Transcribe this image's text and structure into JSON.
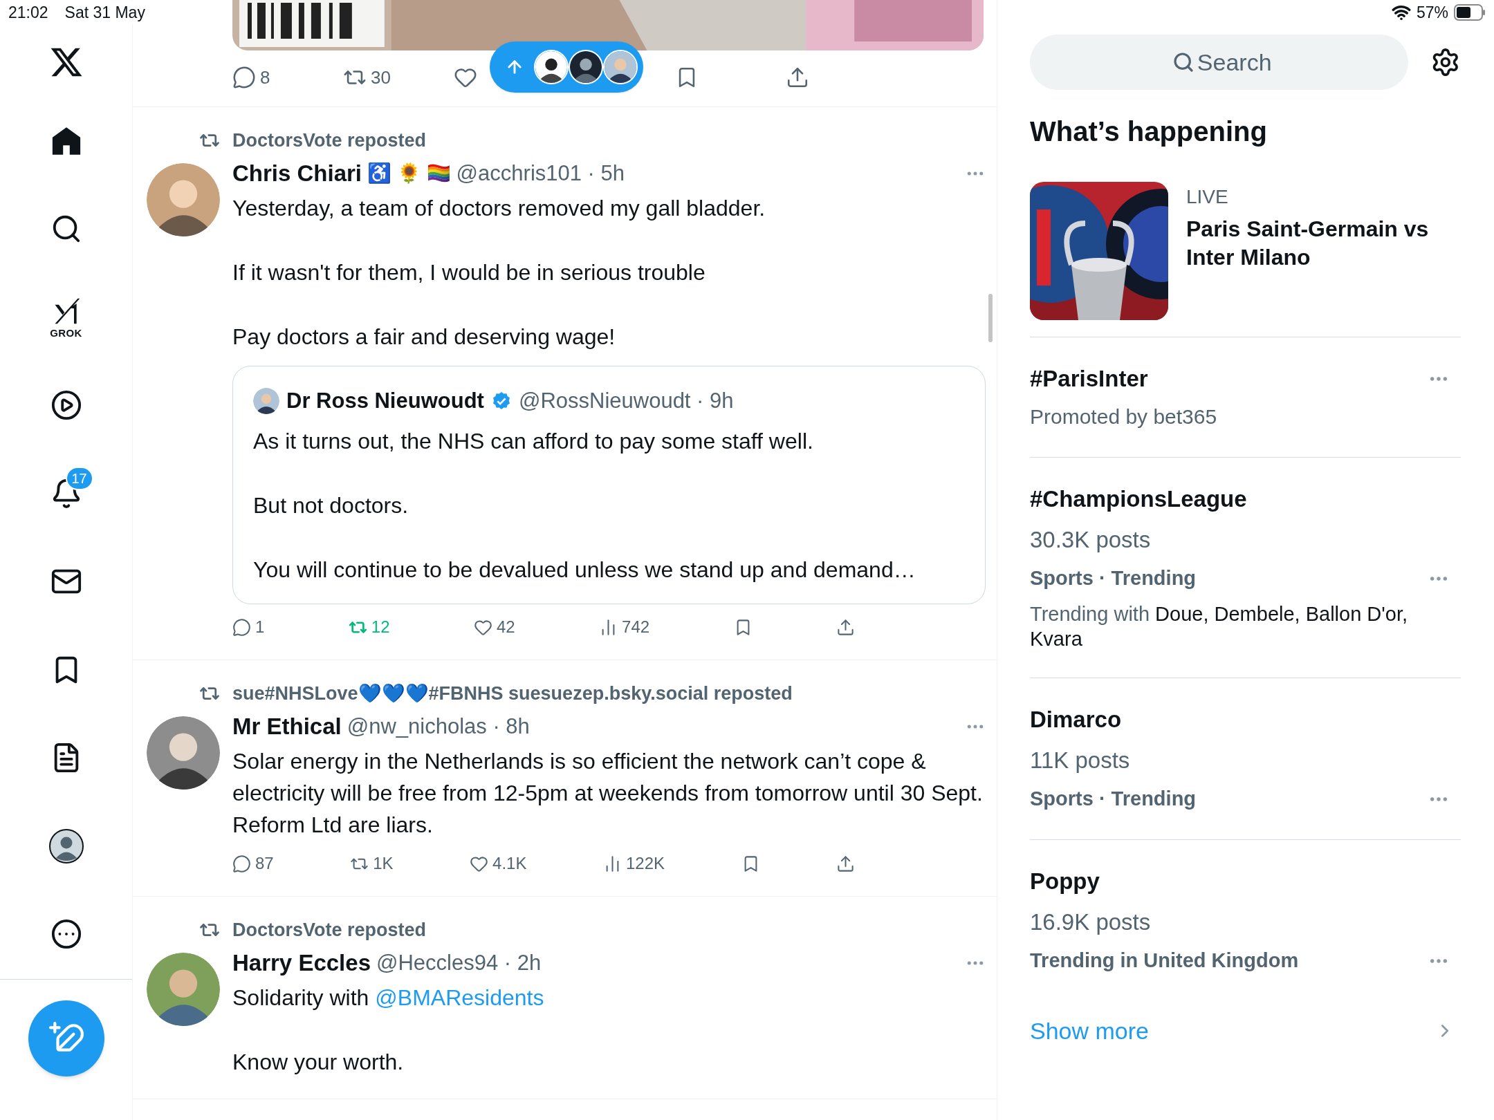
{
  "status_bar": {
    "time": "21:02",
    "date": "Sat 31 May",
    "battery": "57%"
  },
  "sidebar": {
    "items": [
      {
        "kind": "home",
        "selected": true
      },
      {
        "kind": "explore",
        "selected": false
      },
      {
        "kind": "grok",
        "label": "GROK",
        "selected": false
      },
      {
        "kind": "video",
        "selected": false
      },
      {
        "kind": "notifications",
        "badge": "17",
        "selected": false
      },
      {
        "kind": "messages",
        "selected": false
      },
      {
        "kind": "bookmarks",
        "selected": false
      },
      {
        "kind": "lists",
        "selected": false
      },
      {
        "kind": "profile",
        "selected": false
      },
      {
        "kind": "more",
        "selected": false
      }
    ]
  },
  "feed": {
    "top_post": {
      "actions": [
        {
          "kind": "reply",
          "count": "8",
          "active": false
        },
        {
          "kind": "repost",
          "count": "30",
          "active": false
        },
        {
          "kind": "like",
          "active": false
        },
        {
          "kind": "bookmark",
          "active": false
        },
        {
          "kind": "share",
          "active": false
        }
      ]
    },
    "posts": [
      {
        "reposted_by": "DoctorsVote reposted",
        "name": "Chris Chiari",
        "emoji": "♿ 🌻 🏳️‍🌈",
        "meta": "@acchris101 · 5h",
        "paragraphs": [
          {
            "text": "Yesterday, a team of doctors removed my gall bladder."
          },
          {
            "text": "If it wasn't for them, I would be in serious trouble"
          },
          {
            "text": "Pay doctors a fair and deserving wage!"
          }
        ],
        "quote": {
          "name": "Dr Ross Nieuwoudt",
          "verified": true,
          "meta": "@RossNieuwoudt · 9h",
          "paragraphs": [
            "As it turns out, the NHS can afford to pay some staff well.",
            "But not doctors.",
            "You will continue to be devalued unless we stand up and demand…"
          ]
        },
        "actions": [
          {
            "kind": "reply",
            "count": "1",
            "active": false
          },
          {
            "kind": "repost",
            "count": "12",
            "active": true
          },
          {
            "kind": "like",
            "count": "42",
            "active": false
          },
          {
            "kind": "views",
            "count": "742",
            "active": false
          },
          {
            "kind": "bookmark",
            "active": false
          },
          {
            "kind": "share",
            "active": false
          }
        ]
      },
      {
        "reposted_by": "sue#NHSLove💙💙💙#FBNHS suesuezep.bsky.social reposted",
        "name": "Mr Ethical",
        "meta": "@nw_nicholas · 8h",
        "paragraphs": [
          {
            "text": "Solar energy in the Netherlands is so efficient the network can’t cope & electricity will be free from 12-5pm at weekends from tomorrow until 30 Sept. Reform Ltd are liars."
          }
        ],
        "actions": [
          {
            "kind": "reply",
            "count": "87",
            "active": false
          },
          {
            "kind": "repost",
            "count": "1K",
            "active": false
          },
          {
            "kind": "like",
            "count": "4.1K",
            "active": false
          },
          {
            "kind": "views",
            "count": "122K",
            "active": false
          },
          {
            "kind": "bookmark",
            "active": false
          },
          {
            "kind": "share",
            "active": false
          }
        ]
      },
      {
        "reposted_by": "DoctorsVote reposted",
        "name": "Harry Eccles",
        "meta": "@Heccles94 · 2h",
        "paragraphs": [
          {
            "text": "Solidarity with ",
            "link": "@BMAResidents"
          },
          {
            "text": "Know your worth."
          }
        ]
      }
    ]
  },
  "right": {
    "search": {
      "placeholder": "Search"
    },
    "heading": "What’s happening",
    "live_event": {
      "label": "LIVE",
      "title": "Paris Saint-Germain vs Inter Milano"
    },
    "trends": [
      {
        "kind": "promoted",
        "title": "#ParisInter",
        "promoted_by": "Promoted by bet365"
      },
      {
        "kind": "trend",
        "title": "#ChampionsLeague",
        "posts": "30.3K posts",
        "category": "Sports · Trending",
        "trending_with": {
          "label": "Trending with",
          "topics": "Doue, Dembele, Ballon D'or, Kvara"
        }
      },
      {
        "kind": "trend",
        "title": "Dimarco",
        "posts": "11K posts",
        "category": "Sports · Trending"
      },
      {
        "kind": "trend",
        "title": "Poppy",
        "posts": "16.9K posts",
        "category": "Trending in United Kingdom"
      }
    ],
    "show_more": "Show more"
  }
}
